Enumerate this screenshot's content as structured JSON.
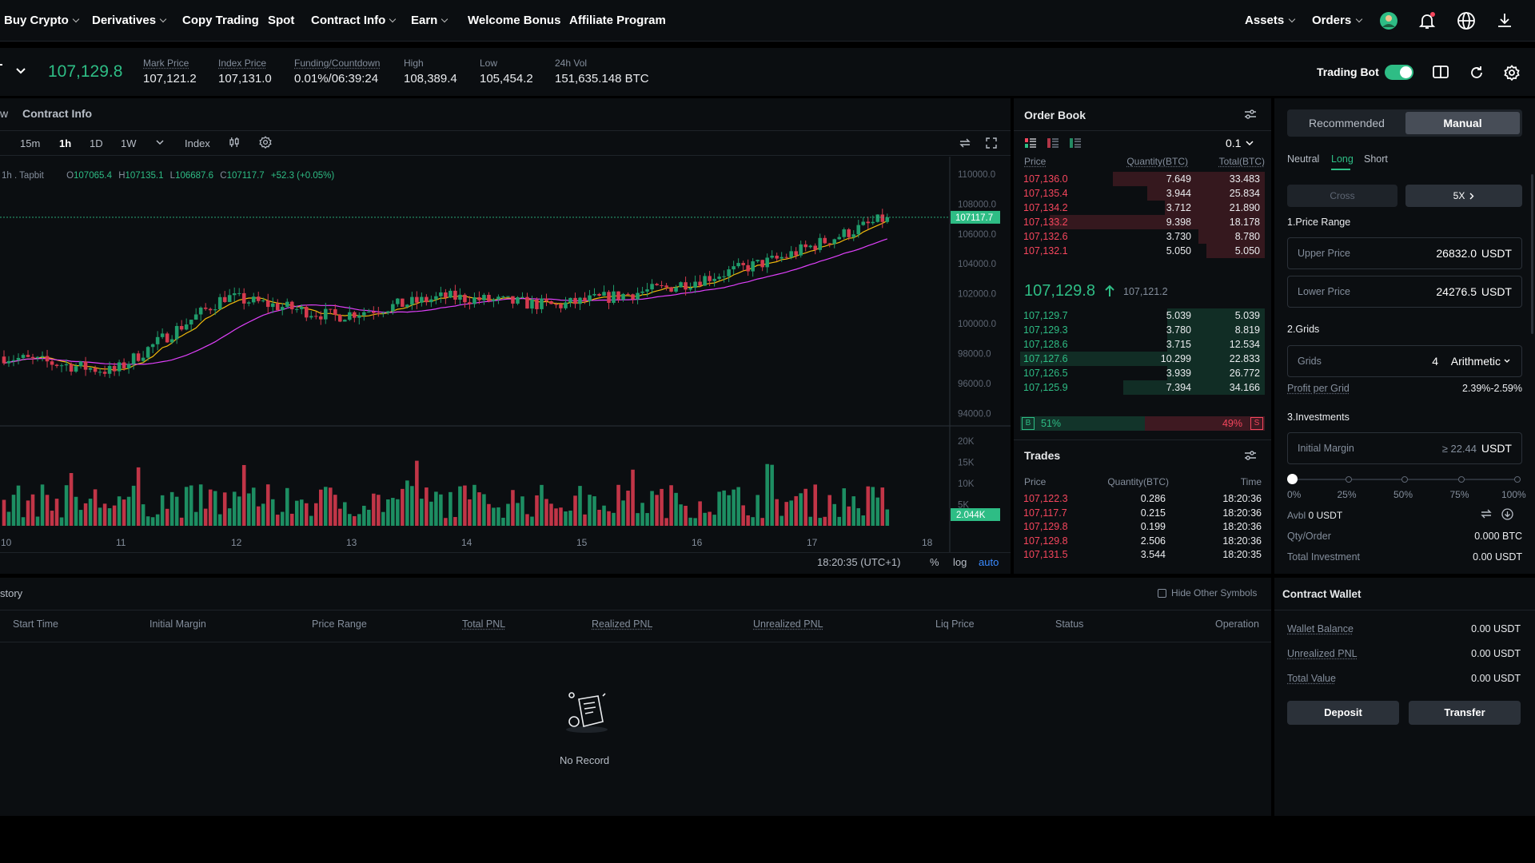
{
  "nav": {
    "items": [
      "Buy Crypto",
      "Derivatives",
      "Copy Trading",
      "Spot",
      "Contract Info",
      "Earn",
      "Welcome Bonus",
      "Affiliate Program"
    ],
    "assets": "Assets",
    "orders": "Orders"
  },
  "ticker": {
    "last_price": "107,129.8",
    "stats": [
      {
        "label": "Mark Price",
        "value": "107,121.2"
      },
      {
        "label": "Index Price",
        "value": "107,131.0"
      },
      {
        "label": "Funding/Countdown",
        "value": "0.01%/06:39:24"
      },
      {
        "label": "High",
        "value": "108,389.4"
      },
      {
        "label": "Low",
        "value": "105,454.2"
      },
      {
        "label": "24h Vol",
        "value": "151,635.148 BTC"
      }
    ],
    "trading_bot_label": "Trading Bot",
    "trading_bot_on": true
  },
  "chart": {
    "tab_partial": "w",
    "tab_contract_info": "Contract Info",
    "timeframes": [
      "15m",
      "1h",
      "1D",
      "1W"
    ],
    "active_timeframe": "1h",
    "index_label": "Index",
    "legend_source": "1h . Tapbit",
    "ohlc": {
      "o_label": "O",
      "o": "107065.4",
      "h_label": "H",
      "h": "107135.1",
      "l_label": "L",
      "l": "106687.6",
      "c_label": "C",
      "c": "107117.7",
      "change": "+52.3 (+0.05%)"
    },
    "price_axis": [
      "110000.0",
      "108000.0",
      "106000.0",
      "104000.0",
      "102000.0",
      "100000.0",
      "98000.0",
      "96000.0",
      "94000.0"
    ],
    "current_price_tag": "107117.7",
    "volume_axis": [
      "20K",
      "15K",
      "10K",
      "5K"
    ],
    "volume_tag": "2.044K",
    "date_axis": [
      "10",
      "11",
      "12",
      "13",
      "14",
      "15",
      "16",
      "17",
      "18"
    ],
    "clock": "18:20:35 (UTC+1)",
    "scale_options": [
      "%",
      "log",
      "auto"
    ],
    "active_scale": "auto"
  },
  "chart_data": {
    "type": "line",
    "title": "",
    "xlabel": "",
    "ylabel": "",
    "x": [
      "10",
      "11",
      "12",
      "13",
      "14",
      "15",
      "16",
      "17",
      "18"
    ],
    "series": [
      {
        "values": [
          97800,
          96800,
          101800,
          100500,
          101800,
          101200,
          102400,
          104300,
          107100
        ]
      }
    ],
    "ylim": [
      93000,
      110000
    ],
    "volume_ylim": [
      0,
      20000
    ],
    "last_close": 107117.7
  },
  "order_book": {
    "title": "Order Book",
    "precision": "0.1",
    "headers": {
      "price": "Price",
      "qty": "Quantity(BTC)",
      "total": "Total(BTC)"
    },
    "asks": [
      {
        "p": "107,136.0",
        "q": "7.649",
        "t": "33.483",
        "depth": 0.62
      },
      {
        "p": "107,135.4",
        "q": "3.944",
        "t": "25.834",
        "depth": 0.48
      },
      {
        "p": "107,134.2",
        "q": "3.712",
        "t": "21.890",
        "depth": 0.41
      },
      {
        "p": "107,133.2",
        "q": "9.398",
        "t": "18.178",
        "depth": 0.88
      },
      {
        "p": "107,132.6",
        "q": "3.730",
        "t": "8.780",
        "depth": 0.27
      },
      {
        "p": "107,132.1",
        "q": "5.050",
        "t": "5.050",
        "depth": 0.24
      }
    ],
    "mid_price": "107,129.8",
    "mid_mark": "107,121.2",
    "bids": [
      {
        "p": "107,129.7",
        "q": "5.039",
        "t": "5.039",
        "depth": 0.4
      },
      {
        "p": "107,129.3",
        "q": "3.780",
        "t": "8.819",
        "depth": 0.4
      },
      {
        "p": "107,128.6",
        "q": "3.715",
        "t": "12.534",
        "depth": 0.4
      },
      {
        "p": "107,127.6",
        "q": "10.299",
        "t": "22.833",
        "depth": 1.0
      },
      {
        "p": "107,126.5",
        "q": "3.939",
        "t": "26.772",
        "depth": 0.4
      },
      {
        "p": "107,125.9",
        "q": "7.394",
        "t": "34.166",
        "depth": 0.58
      }
    ],
    "buy_label": "B",
    "buy_pct": "51%",
    "sell_pct": "49%",
    "sell_label": "S",
    "buy_ratio": 0.51
  },
  "trades": {
    "title": "Trades",
    "headers": {
      "price": "Price",
      "qty": "Quantity(BTC)",
      "time": "Time"
    },
    "rows": [
      {
        "p": "107,122.3",
        "q": "0.286",
        "t": "18:20:36"
      },
      {
        "p": "107,117.7",
        "q": "0.215",
        "t": "18:20:36"
      },
      {
        "p": "107,129.8",
        "q": "0.199",
        "t": "18:20:36"
      },
      {
        "p": "107,129.8",
        "q": "2.506",
        "t": "18:20:36"
      },
      {
        "p": "107,131.5",
        "q": "3.544",
        "t": "18:20:35"
      }
    ]
  },
  "bot": {
    "mode_recommended": "Recommended",
    "mode_manual": "Manual",
    "directions": [
      "Neutral",
      "Long",
      "Short"
    ],
    "active_direction": "Long",
    "cross_label": "Cross",
    "leverage": "5X",
    "price_range_title": "1.Price Range",
    "upper_label": "Upper Price",
    "upper_value": "26832.0",
    "lower_label": "Lower Price",
    "lower_value": "24276.5",
    "unit": "USDT",
    "grids_title": "2.Grids",
    "grids_label": "Grids",
    "grids_value": "4",
    "grids_mode": "Arithmetic",
    "profit_label": "Profit per Grid",
    "profit_value": "2.39%-2.59%",
    "investments_title": "3.Investments",
    "margin_label": "Initial Margin",
    "margin_placeholder": "≥ 22.44",
    "slider_marks": [
      "0%",
      "25%",
      "50%",
      "75%",
      "100%"
    ],
    "slider_value": 0,
    "avbl_label": "Avbl",
    "avbl_value": "0 USDT",
    "qty_label": "Qty/Order",
    "qty_value": "0.000 BTC",
    "total_inv_label": "Total Investment",
    "total_inv_value": "0.00 USDT"
  },
  "history": {
    "title_partial": "story",
    "hide_other_label": "Hide Other Symbols",
    "columns": [
      "Start Time",
      "Initial Margin",
      "Price Range",
      "Total PNL",
      "Realized PNL",
      "Unrealized PNL",
      "Liq Price",
      "Status",
      "Operation"
    ],
    "empty_text": "No Record"
  },
  "wallet": {
    "title": "Contract Wallet",
    "rows": [
      {
        "k": "Wallet Balance",
        "v": "0.00 USDT"
      },
      {
        "k": "Unrealized PNL",
        "v": "0.00 USDT"
      },
      {
        "k": "Total Value",
        "v": "0.00 USDT"
      }
    ],
    "deposit": "Deposit",
    "transfer": "Transfer"
  },
  "colors": {
    "up": "#2ebd85",
    "down": "#f6465d",
    "accent": "#1e88ff"
  }
}
